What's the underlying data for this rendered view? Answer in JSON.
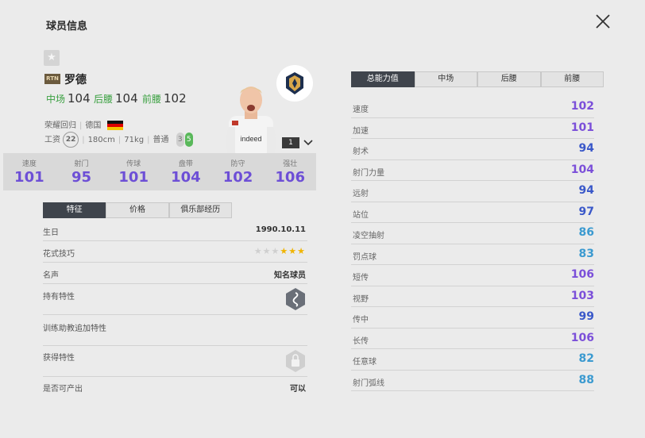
{
  "header": {
    "title": "球员信息"
  },
  "player": {
    "season_badge": "RTN",
    "name": "罗德",
    "positions": [
      {
        "label": "中场",
        "value": "104",
        "color": "#3aa040"
      },
      {
        "label": "后腰",
        "value": "104",
        "color": "#3aa040"
      },
      {
        "label": "前腰",
        "value": "102",
        "color": "#3aa040"
      }
    ],
    "info1": {
      "team": "荣耀回归",
      "nation": "德国"
    },
    "info2": {
      "salary_label": "工资",
      "salary": "22",
      "height": "180cm",
      "weight": "71kg",
      "body": "普通",
      "foot_left": "3",
      "foot_right": "5"
    },
    "level": "1"
  },
  "stat_bar": [
    {
      "label": "速度",
      "value": "101"
    },
    {
      "label": "射门",
      "value": "95"
    },
    {
      "label": "传球",
      "value": "101"
    },
    {
      "label": "盘带",
      "value": "104"
    },
    {
      "label": "防守",
      "value": "102"
    },
    {
      "label": "强壮",
      "value": "106"
    }
  ],
  "left_tabs": [
    {
      "label": "特征"
    },
    {
      "label": "价格"
    },
    {
      "label": "俱乐部经历"
    }
  ],
  "traits": {
    "birthday": {
      "label": "生日",
      "value": "1990.10.11"
    },
    "skill": {
      "label": "花式技巧",
      "stars": 3,
      "max": 6
    },
    "fame": {
      "label": "名声",
      "value": "知名球员"
    },
    "owned": {
      "label": "持有特性"
    },
    "coach": {
      "label": "训练助教追加特性"
    },
    "acquire": {
      "label": "获得特性"
    },
    "producible": {
      "label": "是否可产出",
      "value": "可以"
    }
  },
  "right_tabs": [
    {
      "label": "总能力值"
    },
    {
      "label": "中场"
    },
    {
      "label": "后腰"
    },
    {
      "label": "前腰"
    }
  ],
  "attributes": [
    {
      "label": "速度",
      "value": "102",
      "color": "#7b4fd9"
    },
    {
      "label": "加速",
      "value": "101",
      "color": "#7b4fd9"
    },
    {
      "label": "射术",
      "value": "94",
      "color": "#3a58c9"
    },
    {
      "label": "射门力量",
      "value": "104",
      "color": "#7b4fd9"
    },
    {
      "label": "远射",
      "value": "94",
      "color": "#3a58c9"
    },
    {
      "label": "站位",
      "value": "97",
      "color": "#3a58c9"
    },
    {
      "label": "凌空抽射",
      "value": "86",
      "color": "#3b9ad0"
    },
    {
      "label": "罚点球",
      "value": "83",
      "color": "#3b9ad0"
    },
    {
      "label": "短传",
      "value": "106",
      "color": "#7b4fd9"
    },
    {
      "label": "视野",
      "value": "103",
      "color": "#7b4fd9"
    },
    {
      "label": "传中",
      "value": "99",
      "color": "#3a58c9"
    },
    {
      "label": "长传",
      "value": "106",
      "color": "#7b4fd9"
    },
    {
      "label": "任意球",
      "value": "82",
      "color": "#3b9ad0"
    },
    {
      "label": "射门弧线",
      "value": "88",
      "color": "#3b9ad0"
    }
  ]
}
